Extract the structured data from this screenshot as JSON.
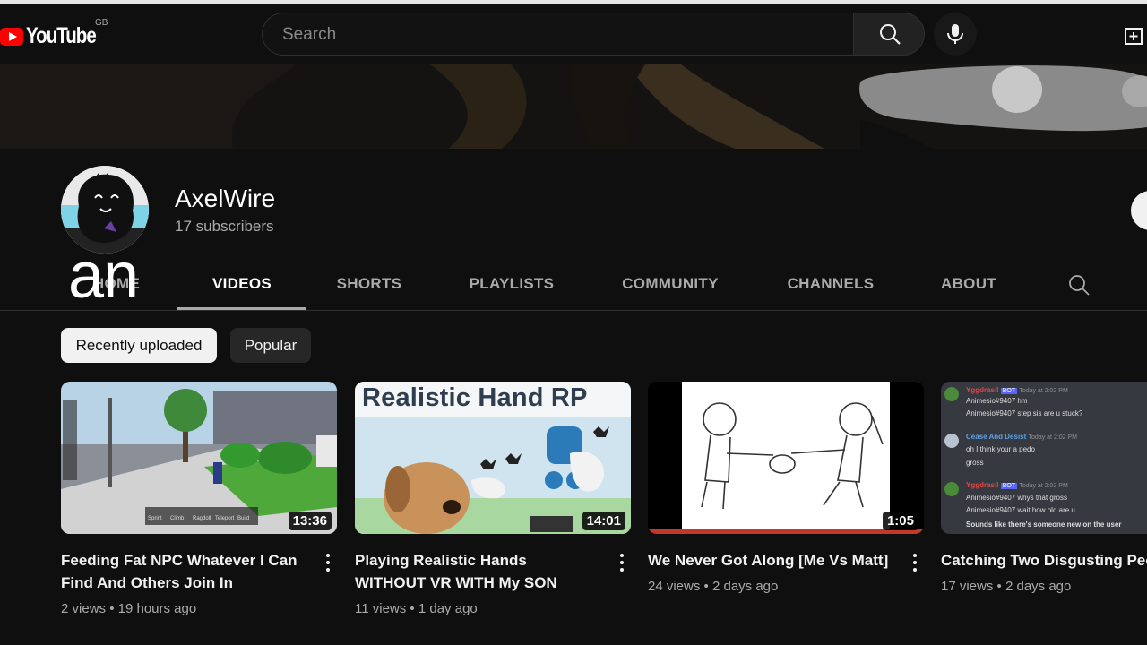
{
  "masthead": {
    "logo_text": "YouTube",
    "region": "GB",
    "search_placeholder": "Search",
    "brand_color": "#ff0000"
  },
  "channel": {
    "name": "AxelWire",
    "subscribers": "17 subscribers"
  },
  "tabs": [
    {
      "label": "HOME",
      "active": false
    },
    {
      "label": "VIDEOS",
      "active": true
    },
    {
      "label": "SHORTS",
      "active": false
    },
    {
      "label": "PLAYLISTS",
      "active": false
    },
    {
      "label": "COMMUNITY",
      "active": false
    },
    {
      "label": "CHANNELS",
      "active": false
    },
    {
      "label": "ABOUT",
      "active": false
    }
  ],
  "overlay_caption": "an",
  "chips": [
    {
      "label": "Recently uploaded",
      "selected": true
    },
    {
      "label": "Popular",
      "selected": false
    }
  ],
  "videos": [
    {
      "title": "Feeding Fat NPC Whatever I Can Find And Others Join In",
      "duration": "13:36",
      "views": "2 views",
      "age": "19 hours ago",
      "thumb_hud": [
        "Sprint",
        "Climb",
        "Ragdoll",
        "Teleport",
        "Build"
      ]
    },
    {
      "title": "Playing Realistic Hands WITHOUT VR WITH My SON",
      "duration": "14:01",
      "views": "11 views",
      "age": "1 day ago",
      "thumb_text": "Realistic Hand RP"
    },
    {
      "title": "We Never Got Along [Me Vs Matt]",
      "duration": "1:05",
      "views": "24 views",
      "age": "2 days ago"
    },
    {
      "title": "Catching Two Disgusting Peop",
      "duration": "",
      "views": "17 views",
      "age": "2 days ago",
      "chat": [
        {
          "user": "Yggdrasil",
          "badge": "BOT",
          "time": "Today at 2:02 PM",
          "lines": [
            "Animesio#9407 hm",
            "Animesio#9407 step sis are u stuck?"
          ]
        },
        {
          "user": "Cease And Desist",
          "time": "Today at 2:02 PM",
          "lines": [
            "oh I think your a pedo",
            "gross"
          ]
        },
        {
          "user": "Yggdrasil",
          "badge": "BOT",
          "time": "Today at 2:02 PM",
          "lines": [
            "Animesio#9407 whys that gross",
            "Animesio#9407 wait how old are u",
            "Sounds like there's someone new on the user"
          ]
        }
      ]
    }
  ],
  "separator": "•"
}
